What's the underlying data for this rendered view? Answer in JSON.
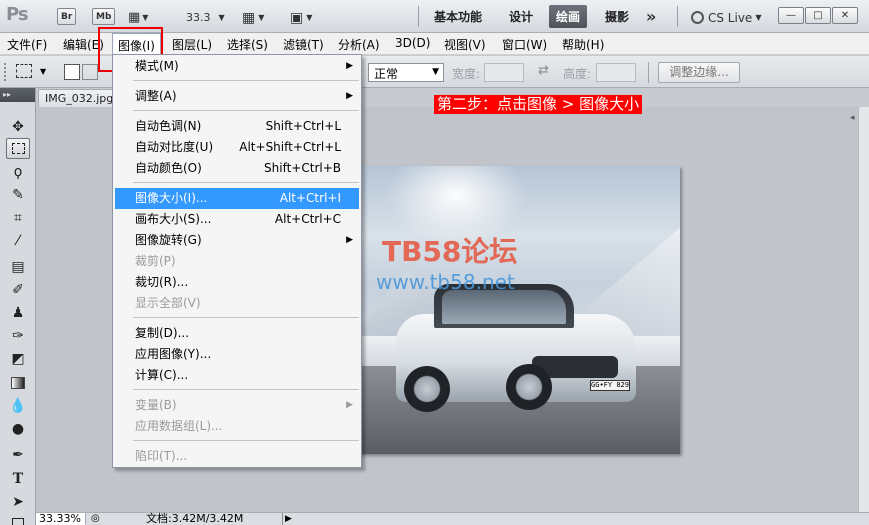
{
  "appbar": {
    "logo": "Ps",
    "bridge_label": "Br",
    "minibridge_label": "Mb",
    "zoom_value": "33.3",
    "workspaces": [
      "基本功能",
      "设计",
      "绘画",
      "摄影"
    ],
    "active_workspace": "绘画",
    "more": "»",
    "cs_live": "CS Live",
    "window_buttons": [
      "—",
      "□",
      "✕"
    ]
  },
  "menubar": {
    "items": [
      "文件(F)",
      "编辑(E)",
      "图像(I)",
      "图层(L)",
      "选择(S)",
      "滤镜(T)",
      "分析(A)",
      "3D(D)",
      "视图(V)",
      "窗口(W)",
      "帮助(H)"
    ],
    "open_item": "图像(I)"
  },
  "options": {
    "mode_value": "正常",
    "width_label": "宽度:",
    "height_label": "高度:",
    "refine_edge": "调整边缘..."
  },
  "document": {
    "tab_title": "IMG_032.jpg",
    "zoom": "33.33%",
    "doc_info": "文档:3.42M/3.42M"
  },
  "banner": "第二步：点击图像 > 图像大小",
  "watermark": {
    "title": "TB58论坛",
    "url": "www.tb58.net"
  },
  "canvas": {
    "plate": "GG•FY 829"
  },
  "dropdown": {
    "items": [
      {
        "label": "模式(M)",
        "shortcut": "",
        "submenu": true,
        "disabled": false
      },
      {
        "label": "调整(A)",
        "shortcut": "",
        "submenu": true,
        "disabled": false
      },
      {
        "label": "自动色调(N)",
        "shortcut": "Shift+Ctrl+L",
        "submenu": false,
        "disabled": false
      },
      {
        "label": "自动对比度(U)",
        "shortcut": "Alt+Shift+Ctrl+L",
        "submenu": false,
        "disabled": false
      },
      {
        "label": "自动颜色(O)",
        "shortcut": "Shift+Ctrl+B",
        "submenu": false,
        "disabled": false
      },
      {
        "label": "图像大小(I)...",
        "shortcut": "Alt+Ctrl+I",
        "submenu": false,
        "disabled": false,
        "highlighted": true
      },
      {
        "label": "画布大小(S)...",
        "shortcut": "Alt+Ctrl+C",
        "submenu": false,
        "disabled": false
      },
      {
        "label": "图像旋转(G)",
        "shortcut": "",
        "submenu": true,
        "disabled": false
      },
      {
        "label": "裁剪(P)",
        "shortcut": "",
        "submenu": false,
        "disabled": true
      },
      {
        "label": "裁切(R)...",
        "shortcut": "",
        "submenu": false,
        "disabled": false
      },
      {
        "label": "显示全部(V)",
        "shortcut": "",
        "submenu": false,
        "disabled": true
      },
      {
        "label": "复制(D)...",
        "shortcut": "",
        "submenu": false,
        "disabled": false
      },
      {
        "label": "应用图像(Y)...",
        "shortcut": "",
        "submenu": false,
        "disabled": false
      },
      {
        "label": "计算(C)...",
        "shortcut": "",
        "submenu": false,
        "disabled": false
      },
      {
        "label": "变量(B)",
        "shortcut": "",
        "submenu": true,
        "disabled": true
      },
      {
        "label": "应用数据组(L)...",
        "shortcut": "",
        "submenu": false,
        "disabled": true
      },
      {
        "label": "陷印(T)...",
        "shortcut": "",
        "submenu": false,
        "disabled": true
      }
    ]
  },
  "tools": [
    "move-tool",
    "marquee-tool",
    "lasso-tool",
    "quick-select-tool",
    "crop-tool",
    "eyedropper-tool",
    "spot-healing-tool",
    "brush-tool",
    "clone-stamp-tool",
    "history-brush-tool",
    "eraser-tool",
    "gradient-tool",
    "blur-tool",
    "dodge-tool",
    "pen-tool",
    "type-tool",
    "path-select-tool",
    "shape-tool"
  ]
}
